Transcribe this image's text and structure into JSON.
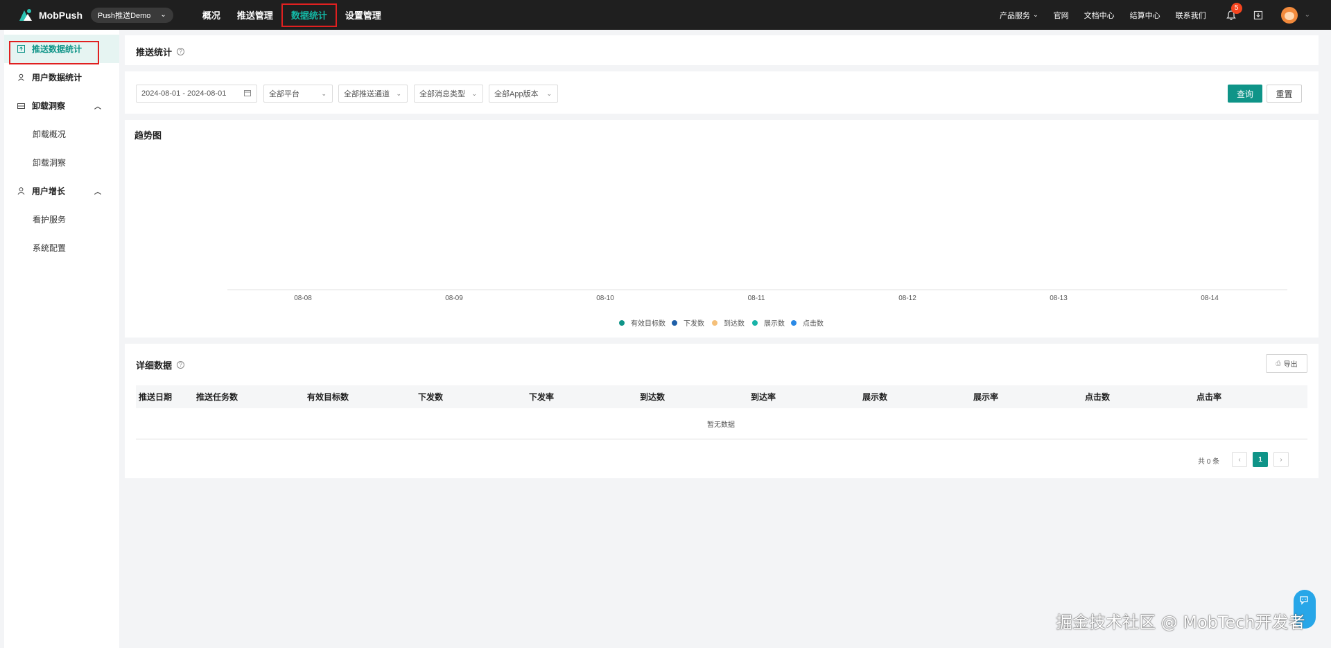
{
  "brand": {
    "name": "MobPush",
    "app_selector": "Push推送Demo"
  },
  "main_nav": [
    {
      "label": "概况"
    },
    {
      "label": "推送管理"
    },
    {
      "label": "数据统计"
    },
    {
      "label": "设置管理"
    }
  ],
  "top_right": {
    "product_services": "产品服务",
    "official_site": "官网",
    "docs": "文档中心",
    "billing": "结算中心",
    "contact": "联系我们",
    "notification_count": "5"
  },
  "sidebar": {
    "items": [
      {
        "label": "推送数据统计"
      },
      {
        "label": "用户数据统计"
      },
      {
        "label": "卸载洞察"
      },
      {
        "label": "卸载概况"
      },
      {
        "label": "卸载洞察"
      },
      {
        "label": "用户增长"
      },
      {
        "label": "看护服务"
      },
      {
        "label": "系统配置"
      }
    ]
  },
  "page": {
    "title": "推送统计"
  },
  "filters": {
    "date_range": "2024-08-01 - 2024-08-01",
    "platform": "全部平台",
    "channel": "全部推送通道",
    "message_type": "全部消息类型",
    "app_version": "全部App版本",
    "query_button": "查询",
    "reset_button": "重置"
  },
  "chart_data": {
    "type": "line",
    "title": "趋势图",
    "categories": [
      "08-08",
      "08-09",
      "08-10",
      "08-11",
      "08-12",
      "08-13",
      "08-14"
    ],
    "series": [
      {
        "name": "有效目标数",
        "color": "#0f9488",
        "values": []
      },
      {
        "name": "下发数",
        "color": "#1e5fa8",
        "values": []
      },
      {
        "name": "到达数",
        "color": "#f5c07a",
        "values": []
      },
      {
        "name": "展示数",
        "color": "#18b3a8",
        "values": []
      },
      {
        "name": "点击数",
        "color": "#2b8ae6",
        "values": []
      }
    ],
    "legend": "bottom",
    "grid": false
  },
  "detail": {
    "title": "详细数据",
    "export_button": "导出",
    "columns": [
      "推送日期",
      "推送任务数",
      "有效目标数",
      "下发数",
      "下发率",
      "到达数",
      "到达率",
      "展示数",
      "展示率",
      "点击数",
      "点击率"
    ],
    "empty_text": "暂无数据",
    "total_text": "共 0 条",
    "current_page": "1"
  },
  "watermark": "掘金技术社区 @ MobTech开发者"
}
